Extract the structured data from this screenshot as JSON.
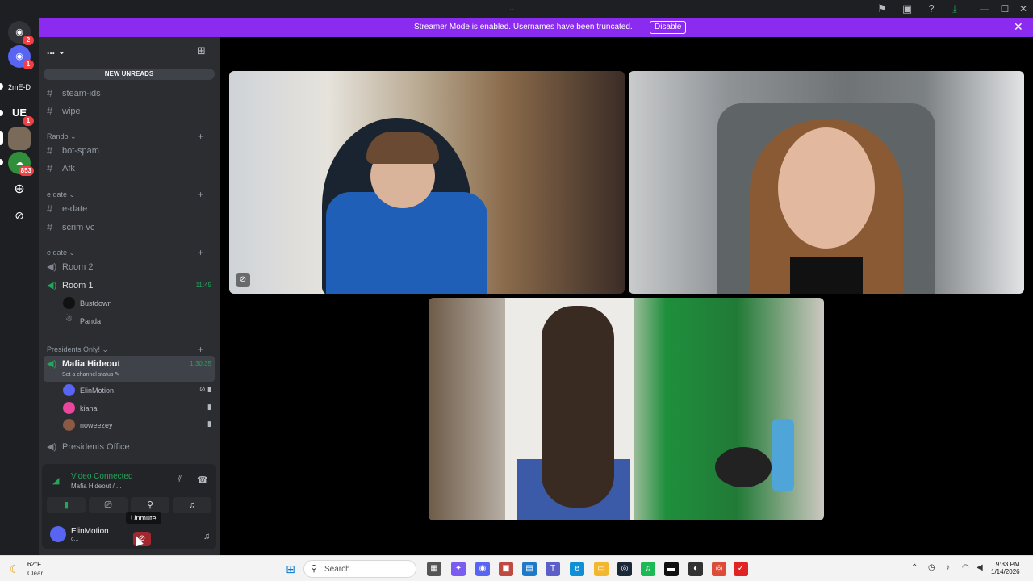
{
  "window": {
    "title": "..."
  },
  "banner": {
    "text": "Streamer Mode is enabled. Usernames have been truncated.",
    "button": "Disable"
  },
  "servers": [
    {
      "label": "",
      "badge": "2",
      "icon": "discord-icon"
    },
    {
      "label": "",
      "badge": "1",
      "icon": "discord-icon"
    },
    {
      "label": "2mE-D",
      "badge": "",
      "icon": "server-text"
    },
    {
      "label": "UE",
      "badge": "1",
      "icon": "ue-icon"
    },
    {
      "label": "",
      "badge": "",
      "icon": "avatar"
    },
    {
      "label": "",
      "badge": "853",
      "icon": "server-avatar"
    }
  ],
  "guild": {
    "name": "...",
    "new_unreads": "NEW UNREADS"
  },
  "channels": {
    "steam_ids": "steam-ids",
    "wipe": "wipe",
    "cat_rando": "Rando",
    "bot_spam": "bot-spam",
    "afk": "Afk",
    "cat_edate1": "e date",
    "e_date": "e-date",
    "scrim_vc": "scrim vc",
    "cat_edate2": "e date",
    "room2": "Room 2",
    "room1": "Room 1",
    "room1_time": "11:45",
    "room1_users": [
      "Bustdown",
      "Panda"
    ],
    "cat_presidents": "Presidents Only!",
    "mafia": "Mafia Hideout",
    "mafia_time": "1:30:35",
    "mafia_status": "Set a channel status",
    "mafia_users": [
      "ElinMotion",
      "kiana",
      "noweezey"
    ],
    "presidents_office": "Presidents Office"
  },
  "voice_panel": {
    "status": "Video Connected",
    "location": "Mafia Hideout / ...",
    "tooltip": "Unmute",
    "username": "ElinMotion",
    "user_sub": "c..."
  },
  "taskbar": {
    "temp": "62°F",
    "condition": "Clear",
    "search": "Search",
    "time": "9:33 PM",
    "date": "1/14/2026"
  }
}
